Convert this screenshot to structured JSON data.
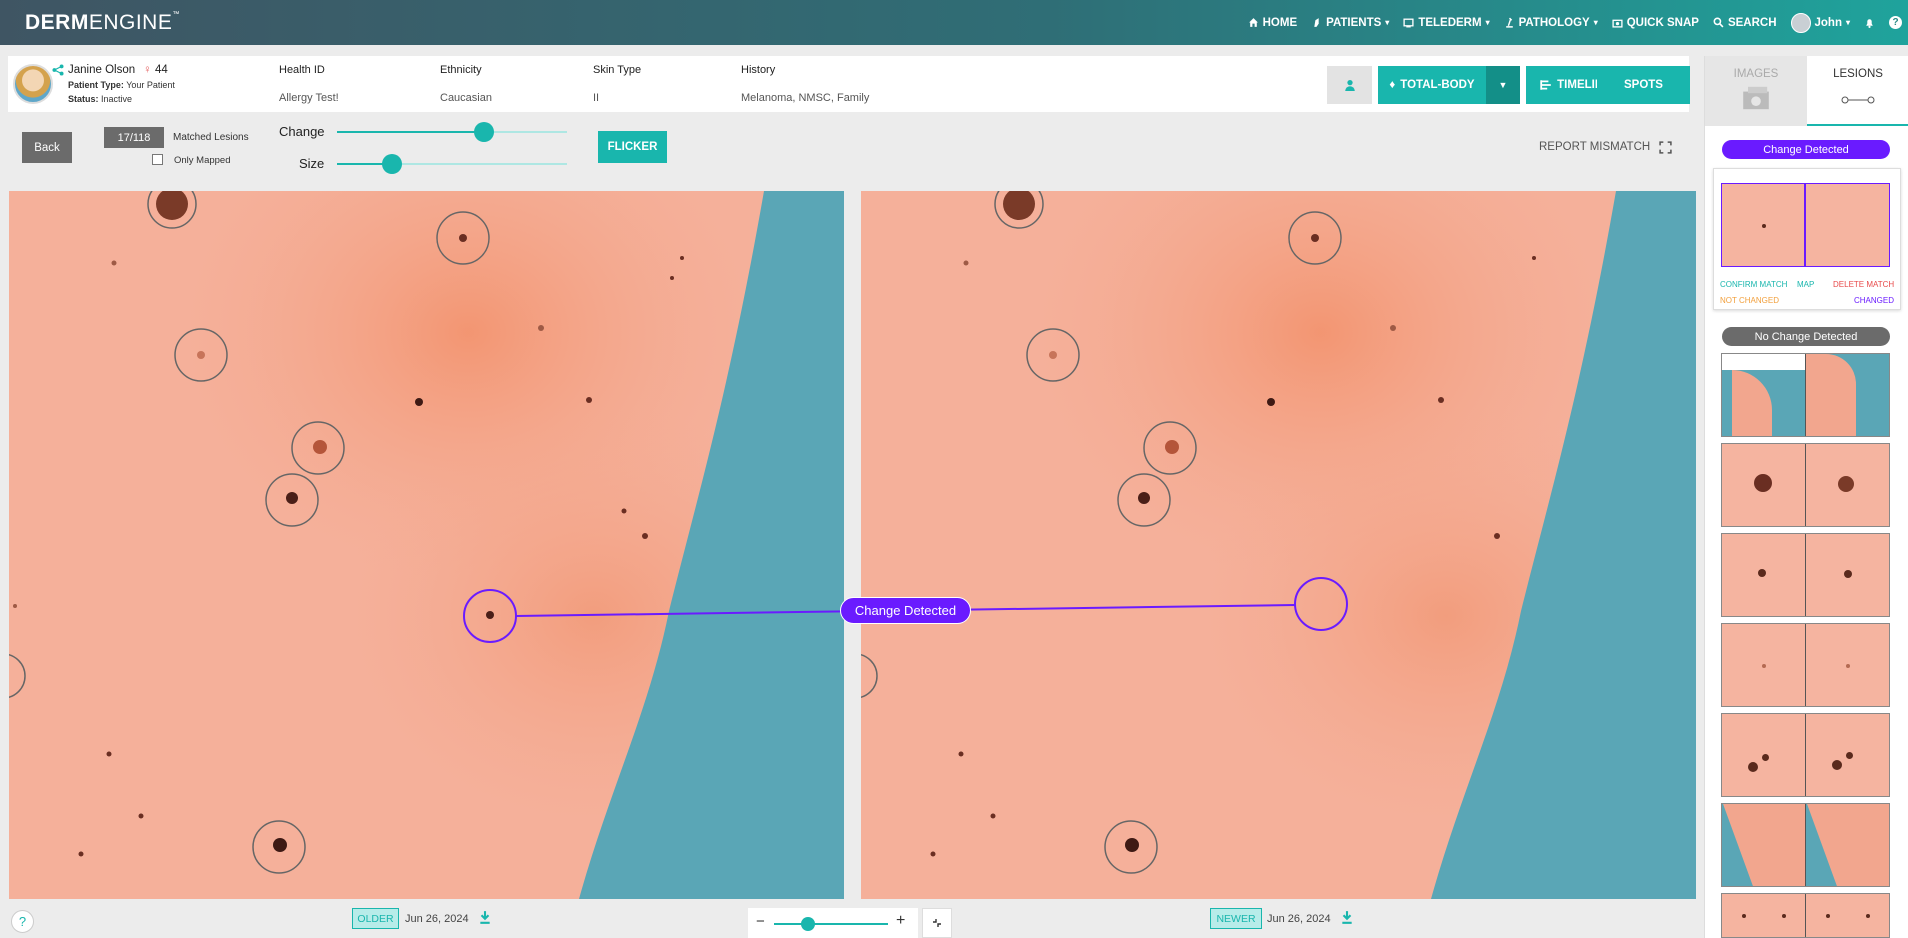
{
  "header": {
    "logo_bold": "DERM",
    "logo_rest": "ENGINE",
    "logo_tm": "™",
    "nav": [
      {
        "label": "HOME",
        "icon": "home-icon"
      },
      {
        "label": "PATIENTS",
        "icon": "patients-icon",
        "caret": "▾"
      },
      {
        "label": "TELEDERM",
        "icon": "telederm-icon",
        "caret": "▾"
      },
      {
        "label": "PATHOLOGY",
        "icon": "pathology-icon",
        "caret": "▾"
      },
      {
        "label": "QUICK SNAP",
        "icon": "quick-snap-icon"
      },
      {
        "label": "SEARCH",
        "icon": "search-icon"
      }
    ],
    "user": {
      "name": "John",
      "caret": "▾"
    },
    "help": "?"
  },
  "patient": {
    "name": "Janine Olson",
    "age": "44",
    "type_label": "Patient Type:",
    "type_value": "Your Patient",
    "status_label": "Status:",
    "status_value": "Inactive",
    "fields": [
      {
        "label": "Health ID",
        "value": "Allergy Test!"
      },
      {
        "label": "Ethnicity",
        "value": "Caucasian"
      },
      {
        "label": "Skin Type",
        "value": "II"
      },
      {
        "label": "History",
        "value": "Melanoma, NMSC, Family"
      }
    ]
  },
  "top_buttons": {
    "total_body": "TOTAL-BODY",
    "timeline": "TIMELINE",
    "spots": "SPOTS"
  },
  "tools": {
    "back": "Back",
    "count": "17/118",
    "matched_label": "Matched Lesions",
    "only_mapped": "Only Mapped",
    "only_mapped_checked": false,
    "change_label": "Change",
    "change_value": 0.64,
    "size_label": "Size",
    "size_value": 0.24,
    "flicker": "FLICKER",
    "report_mismatch": "REPORT MISMATCH"
  },
  "compare": {
    "change_detected": "Change Detected",
    "older_tag": "OLDER",
    "older_date": "Jun 26, 2024",
    "newer_tag": "NEWER",
    "newer_date": "Jun 26, 2024",
    "zoom_minus": "−",
    "zoom_plus": "+",
    "zoom_value": 0.3,
    "help": "?"
  },
  "sidebar": {
    "tab_images": "IMAGES",
    "tab_lesions": "LESIONS",
    "change_detected": "Change Detected",
    "confirm_match": "CONFIRM MATCH",
    "map": "MAP",
    "delete_match": "DELETE MATCH",
    "not_changed": "NOT CHANGED",
    "changed": "CHANGED",
    "no_change_detected": "No Change Detected"
  },
  "colors": {
    "teal": "#19b6ad",
    "purple": "#6a1bff",
    "header_dark": "#3f5563"
  }
}
